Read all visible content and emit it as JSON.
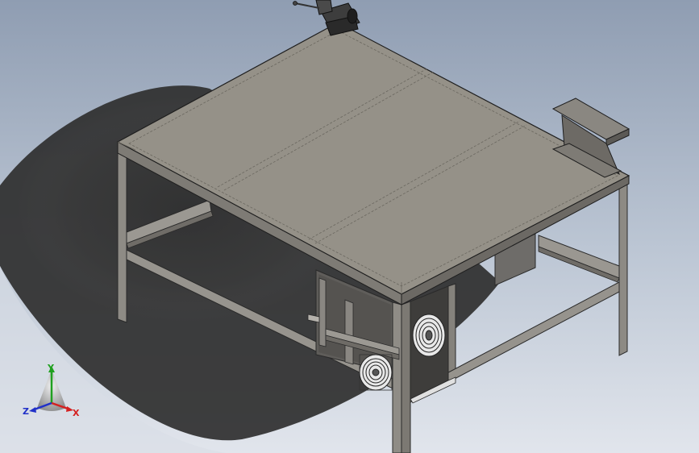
{
  "viewport": {
    "background_top": "#8f9db2",
    "background_bottom": "#dfe4ec"
  },
  "model": {
    "name": "workbench",
    "parts": [
      "table-top",
      "frame-legs",
      "lower-rails",
      "bench-vise",
      "angle-bracket",
      "cabinet-panel",
      "cooling-fan-front",
      "cooling-fan-side",
      "hanging-plate"
    ]
  },
  "triad": {
    "x_label": "X",
    "y_label": "Y",
    "z_label": "Z",
    "x_color": "#d42020",
    "y_color": "#20a020",
    "z_color": "#2030c8"
  }
}
